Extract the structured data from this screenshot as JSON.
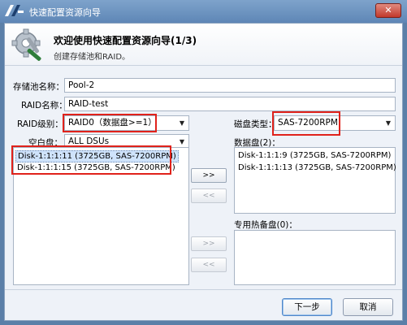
{
  "window": {
    "title": "快速配置资源向导"
  },
  "header": {
    "title": "欢迎使用快速配置资源向导(1/3)",
    "subtitle": "创建存储池和RAID。"
  },
  "form": {
    "pool_label": "存储池名称：",
    "pool_value": "Pool-2",
    "raid_name_label": "RAID名称：",
    "raid_name_value": "RAID-test",
    "raid_level_label": "RAID级别：",
    "raid_level_value": "RAID0（数据盘>=1）",
    "free_disk_label": "空白盘：",
    "free_disk_value": "ALL DSUs",
    "disk_type_label": "磁盘类型：",
    "disk_type_value": "SAS-7200RPM",
    "data_disk_label": "数据盘(2)：",
    "hot_spare_label": "专用热备盘(0)："
  },
  "free_disks": [
    "Disk-1:1:1:11 (3725GB, SAS-7200RPM)",
    "Disk-1:1:1:15 (3725GB, SAS-7200RPM)"
  ],
  "data_disks": [
    "Disk-1:1:1:9 (3725GB, SAS-7200RPM)",
    "Disk-1:1:1:13 (3725GB, SAS-7200RPM)"
  ],
  "buttons": {
    "add_data": ">>",
    "remove_data": "<<",
    "add_spare": ">>",
    "remove_spare": "<<",
    "next": "下一步",
    "cancel": "取消",
    "close": "✕"
  }
}
